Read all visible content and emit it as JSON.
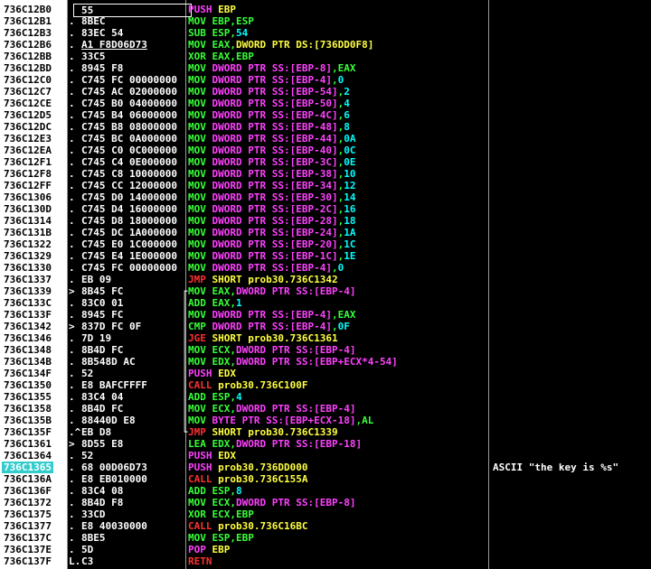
{
  "rows": [
    {
      "addr": "736C12B0",
      "mark": "",
      "hex": "55",
      "flow": "",
      "op": "PUSH",
      "opcolor": "#ff40ff",
      "args": [
        {
          "t": "EBP",
          "c": "#ffff40"
        }
      ],
      "cmt": "",
      "hdr": true
    },
    {
      "addr": "736C12B1",
      "mark": ".",
      "hex": "8BEC",
      "flow": "",
      "op": "MOV",
      "opcolor": "#38ff38",
      "args": [
        {
          "t": "EBP,ESP",
          "c": "#38ff38"
        }
      ],
      "cmt": ""
    },
    {
      "addr": "736C12B3",
      "mark": ".",
      "hex": "83EC 54",
      "flow": "",
      "op": "SUB",
      "opcolor": "#38ff38",
      "args": [
        {
          "t": "ESP,",
          "c": "#38ff38"
        },
        {
          "t": "54",
          "c": "#00ffff"
        }
      ],
      "cmt": ""
    },
    {
      "addr": "736C12B6",
      "mark": ".",
      "hex": "A1 F8D06D73",
      "flow": "",
      "op": "MOV",
      "opcolor": "#38ff38",
      "args": [
        {
          "t": "EAX,",
          "c": "#38ff38"
        },
        {
          "t": "DWORD PTR DS:[736DD0F8]",
          "c": "#ffff40"
        }
      ],
      "cmt": "",
      "ul": true
    },
    {
      "addr": "736C12BB",
      "mark": ".",
      "hex": "33C5",
      "flow": "",
      "op": "XOR",
      "opcolor": "#38ff38",
      "args": [
        {
          "t": "EAX,EBP",
          "c": "#38ff38"
        }
      ],
      "cmt": ""
    },
    {
      "addr": "736C12BD",
      "mark": ".",
      "hex": "8945 F8",
      "flow": "",
      "op": "MOV",
      "opcolor": "#38ff38",
      "args": [
        {
          "t": "DWORD PTR SS:[EBP-8]",
          "c": "#ff40ff"
        },
        {
          "t": ",EAX",
          "c": "#38ff38"
        }
      ],
      "cmt": ""
    },
    {
      "addr": "736C12C0",
      "mark": ".",
      "hex": "C745 FC 00000000",
      "flow": "",
      "op": "MOV",
      "opcolor": "#38ff38",
      "args": [
        {
          "t": "DWORD PTR SS:[EBP-4]",
          "c": "#ff40ff"
        },
        {
          "t": ",",
          "c": "#38ff38"
        },
        {
          "t": "0",
          "c": "#00ffff"
        }
      ],
      "cmt": ""
    },
    {
      "addr": "736C12C7",
      "mark": ".",
      "hex": "C745 AC 02000000",
      "flow": "",
      "op": "MOV",
      "opcolor": "#38ff38",
      "args": [
        {
          "t": "DWORD PTR SS:[EBP-54]",
          "c": "#ff40ff"
        },
        {
          "t": ",",
          "c": "#38ff38"
        },
        {
          "t": "2",
          "c": "#00ffff"
        }
      ],
      "cmt": ""
    },
    {
      "addr": "736C12CE",
      "mark": ".",
      "hex": "C745 B0 04000000",
      "flow": "",
      "op": "MOV",
      "opcolor": "#38ff38",
      "args": [
        {
          "t": "DWORD PTR SS:[EBP-50]",
          "c": "#ff40ff"
        },
        {
          "t": ",",
          "c": "#38ff38"
        },
        {
          "t": "4",
          "c": "#00ffff"
        }
      ],
      "cmt": ""
    },
    {
      "addr": "736C12D5",
      "mark": ".",
      "hex": "C745 B4 06000000",
      "flow": "",
      "op": "MOV",
      "opcolor": "#38ff38",
      "args": [
        {
          "t": "DWORD PTR SS:[EBP-4C]",
          "c": "#ff40ff"
        },
        {
          "t": ",",
          "c": "#38ff38"
        },
        {
          "t": "6",
          "c": "#00ffff"
        }
      ],
      "cmt": ""
    },
    {
      "addr": "736C12DC",
      "mark": ".",
      "hex": "C745 B8 08000000",
      "flow": "",
      "op": "MOV",
      "opcolor": "#38ff38",
      "args": [
        {
          "t": "DWORD PTR SS:[EBP-48]",
          "c": "#ff40ff"
        },
        {
          "t": ",",
          "c": "#38ff38"
        },
        {
          "t": "8",
          "c": "#00ffff"
        }
      ],
      "cmt": ""
    },
    {
      "addr": "736C12E3",
      "mark": ".",
      "hex": "C745 BC 0A000000",
      "flow": "",
      "op": "MOV",
      "opcolor": "#38ff38",
      "args": [
        {
          "t": "DWORD PTR SS:[EBP-44]",
          "c": "#ff40ff"
        },
        {
          "t": ",",
          "c": "#38ff38"
        },
        {
          "t": "0A",
          "c": "#00ffff"
        }
      ],
      "cmt": ""
    },
    {
      "addr": "736C12EA",
      "mark": ".",
      "hex": "C745 C0 0C000000",
      "flow": "",
      "op": "MOV",
      "opcolor": "#38ff38",
      "args": [
        {
          "t": "DWORD PTR SS:[EBP-40]",
          "c": "#ff40ff"
        },
        {
          "t": ",",
          "c": "#38ff38"
        },
        {
          "t": "0C",
          "c": "#00ffff"
        }
      ],
      "cmt": ""
    },
    {
      "addr": "736C12F1",
      "mark": ".",
      "hex": "C745 C4 0E000000",
      "flow": "",
      "op": "MOV",
      "opcolor": "#38ff38",
      "args": [
        {
          "t": "DWORD PTR SS:[EBP-3C]",
          "c": "#ff40ff"
        },
        {
          "t": ",",
          "c": "#38ff38"
        },
        {
          "t": "0E",
          "c": "#00ffff"
        }
      ],
      "cmt": ""
    },
    {
      "addr": "736C12F8",
      "mark": ".",
      "hex": "C745 C8 10000000",
      "flow": "",
      "op": "MOV",
      "opcolor": "#38ff38",
      "args": [
        {
          "t": "DWORD PTR SS:[EBP-38]",
          "c": "#ff40ff"
        },
        {
          "t": ",",
          "c": "#38ff38"
        },
        {
          "t": "10",
          "c": "#00ffff"
        }
      ],
      "cmt": ""
    },
    {
      "addr": "736C12FF",
      "mark": ".",
      "hex": "C745 CC 12000000",
      "flow": "",
      "op": "MOV",
      "opcolor": "#38ff38",
      "args": [
        {
          "t": "DWORD PTR SS:[EBP-34]",
          "c": "#ff40ff"
        },
        {
          "t": ",",
          "c": "#38ff38"
        },
        {
          "t": "12",
          "c": "#00ffff"
        }
      ],
      "cmt": ""
    },
    {
      "addr": "736C1306",
      "mark": ".",
      "hex": "C745 D0 14000000",
      "flow": "",
      "op": "MOV",
      "opcolor": "#38ff38",
      "args": [
        {
          "t": "DWORD PTR SS:[EBP-30]",
          "c": "#ff40ff"
        },
        {
          "t": ",",
          "c": "#38ff38"
        },
        {
          "t": "14",
          "c": "#00ffff"
        }
      ],
      "cmt": ""
    },
    {
      "addr": "736C130D",
      "mark": ".",
      "hex": "C745 D4 16000000",
      "flow": "",
      "op": "MOV",
      "opcolor": "#38ff38",
      "args": [
        {
          "t": "DWORD PTR SS:[EBP-2C]",
          "c": "#ff40ff"
        },
        {
          "t": ",",
          "c": "#38ff38"
        },
        {
          "t": "16",
          "c": "#00ffff"
        }
      ],
      "cmt": ""
    },
    {
      "addr": "736C1314",
      "mark": ".",
      "hex": "C745 D8 18000000",
      "flow": "",
      "op": "MOV",
      "opcolor": "#38ff38",
      "args": [
        {
          "t": "DWORD PTR SS:[EBP-28]",
          "c": "#ff40ff"
        },
        {
          "t": ",",
          "c": "#38ff38"
        },
        {
          "t": "18",
          "c": "#00ffff"
        }
      ],
      "cmt": ""
    },
    {
      "addr": "736C131B",
      "mark": ".",
      "hex": "C745 DC 1A000000",
      "flow": "",
      "op": "MOV",
      "opcolor": "#38ff38",
      "args": [
        {
          "t": "DWORD PTR SS:[EBP-24]",
          "c": "#ff40ff"
        },
        {
          "t": ",",
          "c": "#38ff38"
        },
        {
          "t": "1A",
          "c": "#00ffff"
        }
      ],
      "cmt": ""
    },
    {
      "addr": "736C1322",
      "mark": ".",
      "hex": "C745 E0 1C000000",
      "flow": "",
      "op": "MOV",
      "opcolor": "#38ff38",
      "args": [
        {
          "t": "DWORD PTR SS:[EBP-20]",
          "c": "#ff40ff"
        },
        {
          "t": ",",
          "c": "#38ff38"
        },
        {
          "t": "1C",
          "c": "#00ffff"
        }
      ],
      "cmt": ""
    },
    {
      "addr": "736C1329",
      "mark": ".",
      "hex": "C745 E4 1E000000",
      "flow": "",
      "op": "MOV",
      "opcolor": "#38ff38",
      "args": [
        {
          "t": "DWORD PTR SS:[EBP-1C]",
          "c": "#ff40ff"
        },
        {
          "t": ",",
          "c": "#38ff38"
        },
        {
          "t": "1E",
          "c": "#00ffff"
        }
      ],
      "cmt": ""
    },
    {
      "addr": "736C1330",
      "mark": ".",
      "hex": "C745 FC 00000000",
      "flow": "",
      "op": "MOV",
      "opcolor": "#38ff38",
      "args": [
        {
          "t": "DWORD PTR SS:[EBP-4]",
          "c": "#ff40ff"
        },
        {
          "t": ",",
          "c": "#38ff38"
        },
        {
          "t": "0",
          "c": "#00ffff"
        }
      ],
      "cmt": ""
    },
    {
      "addr": "736C1337",
      "mark": ".",
      "hex": "EB 09",
      "flow": "",
      "op": "JMP",
      "opcolor": "#ff3030",
      "args": [
        {
          "t": "SHORT prob30.736C1342",
          "c": "#ffff40"
        }
      ],
      "cmt": ""
    },
    {
      "addr": "736C1339",
      "mark": ">",
      "hex": "8B45 FC",
      "flow": "┌",
      "op": "MOV",
      "opcolor": "#38ff38",
      "args": [
        {
          "t": "EAX,",
          "c": "#38ff38"
        },
        {
          "t": "DWORD PTR SS:[EBP-4]",
          "c": "#ff40ff"
        }
      ],
      "cmt": ""
    },
    {
      "addr": "736C133C",
      "mark": ".",
      "hex": "83C0 01",
      "flow": "│",
      "op": "ADD",
      "opcolor": "#38ff38",
      "args": [
        {
          "t": "EAX,",
          "c": "#38ff38"
        },
        {
          "t": "1",
          "c": "#00ffff"
        }
      ],
      "cmt": ""
    },
    {
      "addr": "736C133F",
      "mark": ".",
      "hex": "8945 FC",
      "flow": "│",
      "op": "MOV",
      "opcolor": "#38ff38",
      "args": [
        {
          "t": "DWORD PTR SS:[EBP-4]",
          "c": "#ff40ff"
        },
        {
          "t": ",EAX",
          "c": "#38ff38"
        }
      ],
      "cmt": ""
    },
    {
      "addr": "736C1342",
      "mark": ">",
      "hex": "837D FC 0F",
      "flow": "│",
      "op": "CMP",
      "opcolor": "#38ff38",
      "args": [
        {
          "t": "DWORD PTR SS:[EBP-4]",
          "c": "#ff40ff"
        },
        {
          "t": ",",
          "c": "#38ff38"
        },
        {
          "t": "0F",
          "c": "#00ffff"
        }
      ],
      "cmt": ""
    },
    {
      "addr": "736C1346",
      "mark": ".",
      "hex": "7D 19",
      "flow": "│",
      "op": "JGE",
      "opcolor": "#ff3030",
      "args": [
        {
          "t": "SHORT prob30.736C1361",
          "c": "#ffff40"
        }
      ],
      "cmt": ""
    },
    {
      "addr": "736C1348",
      "mark": ".",
      "hex": "8B4D FC",
      "flow": "│",
      "op": "MOV",
      "opcolor": "#38ff38",
      "args": [
        {
          "t": "ECX,",
          "c": "#38ff38"
        },
        {
          "t": "DWORD PTR SS:[EBP-4]",
          "c": "#ff40ff"
        }
      ],
      "cmt": ""
    },
    {
      "addr": "736C134B",
      "mark": ".",
      "hex": "8B548D AC",
      "flow": "│",
      "op": "MOV",
      "opcolor": "#38ff38",
      "args": [
        {
          "t": "EDX,",
          "c": "#38ff38"
        },
        {
          "t": "DWORD PTR SS:[EBP+ECX*4-54]",
          "c": "#ff40ff"
        }
      ],
      "cmt": ""
    },
    {
      "addr": "736C134F",
      "mark": ".",
      "hex": "52",
      "flow": "│",
      "op": "PUSH",
      "opcolor": "#ff40ff",
      "args": [
        {
          "t": "EDX",
          "c": "#ffff40"
        }
      ],
      "cmt": ""
    },
    {
      "addr": "736C1350",
      "mark": ".",
      "hex": "E8 BAFCFFFF",
      "flow": "│",
      "op": "CALL",
      "opcolor": "#ff3030",
      "args": [
        {
          "t": "prob30.736C100F",
          "c": "#ffff40"
        }
      ],
      "cmt": ""
    },
    {
      "addr": "736C1355",
      "mark": ".",
      "hex": "83C4 04",
      "flow": "│",
      "op": "ADD",
      "opcolor": "#38ff38",
      "args": [
        {
          "t": "ESP,",
          "c": "#38ff38"
        },
        {
          "t": "4",
          "c": "#00ffff"
        }
      ],
      "cmt": ""
    },
    {
      "addr": "736C1358",
      "mark": ".",
      "hex": "8B4D FC",
      "flow": "│",
      "op": "MOV",
      "opcolor": "#38ff38",
      "args": [
        {
          "t": "ECX,",
          "c": "#38ff38"
        },
        {
          "t": "DWORD PTR SS:[EBP-4]",
          "c": "#ff40ff"
        }
      ],
      "cmt": ""
    },
    {
      "addr": "736C135B",
      "mark": ".",
      "hex": "88440D E8",
      "flow": "│",
      "op": "MOV",
      "opcolor": "#38ff38",
      "args": [
        {
          "t": "BYTE PTR SS:[EBP+ECX-18]",
          "c": "#ff40ff"
        },
        {
          "t": ",AL",
          "c": "#38ff38"
        }
      ],
      "cmt": ""
    },
    {
      "addr": "736C135F",
      "mark": ".^",
      "hex": "EB D8",
      "flow": "└",
      "op": "JMP",
      "opcolor": "#ff3030",
      "args": [
        {
          "t": "SHORT prob30.736C1339",
          "c": "#ffff40"
        }
      ],
      "cmt": ""
    },
    {
      "addr": "736C1361",
      "mark": ">",
      "hex": "8D55 E8",
      "flow": "",
      "op": "LEA",
      "opcolor": "#38ff38",
      "args": [
        {
          "t": "EDX,",
          "c": "#38ff38"
        },
        {
          "t": "DWORD PTR SS:[EBP-18]",
          "c": "#ff40ff"
        }
      ],
      "cmt": ""
    },
    {
      "addr": "736C1364",
      "mark": ".",
      "hex": "52",
      "flow": "",
      "op": "PUSH",
      "opcolor": "#ff40ff",
      "args": [
        {
          "t": "EDX",
          "c": "#ffff40"
        }
      ],
      "cmt": ""
    },
    {
      "addr": "736C1365",
      "mark": ".",
      "hex": "68 00D06D73",
      "flow": "",
      "op": "PUSH",
      "opcolor": "#ff40ff",
      "args": [
        {
          "t": "prob30.736DD000",
          "c": "#ffff40"
        }
      ],
      "cmt": "ASCII \"the key is %s\"",
      "sel": true
    },
    {
      "addr": "736C136A",
      "mark": ".",
      "hex": "E8 EB010000",
      "flow": "",
      "op": "CALL",
      "opcolor": "#ff3030",
      "args": [
        {
          "t": "prob30.736C155A",
          "c": "#ffff40"
        }
      ],
      "cmt": ""
    },
    {
      "addr": "736C136F",
      "mark": ".",
      "hex": "83C4 08",
      "flow": "",
      "op": "ADD",
      "opcolor": "#38ff38",
      "args": [
        {
          "t": "ESP,",
          "c": "#38ff38"
        },
        {
          "t": "8",
          "c": "#00ffff"
        }
      ],
      "cmt": ""
    },
    {
      "addr": "736C1372",
      "mark": ".",
      "hex": "8B4D F8",
      "flow": "",
      "op": "MOV",
      "opcolor": "#38ff38",
      "args": [
        {
          "t": "ECX,",
          "c": "#38ff38"
        },
        {
          "t": "DWORD PTR SS:[EBP-8]",
          "c": "#ff40ff"
        }
      ],
      "cmt": ""
    },
    {
      "addr": "736C1375",
      "mark": ".",
      "hex": "33CD",
      "flow": "",
      "op": "XOR",
      "opcolor": "#38ff38",
      "args": [
        {
          "t": "ECX,EBP",
          "c": "#38ff38"
        }
      ],
      "cmt": ""
    },
    {
      "addr": "736C1377",
      "mark": ".",
      "hex": "E8 40030000",
      "flow": "",
      "op": "CALL",
      "opcolor": "#ff3030",
      "args": [
        {
          "t": "prob30.736C16BC",
          "c": "#ffff40"
        }
      ],
      "cmt": ""
    },
    {
      "addr": "736C137C",
      "mark": ".",
      "hex": "8BE5",
      "flow": "",
      "op": "MOV",
      "opcolor": "#38ff38",
      "args": [
        {
          "t": "ESP,EBP",
          "c": "#38ff38"
        }
      ],
      "cmt": ""
    },
    {
      "addr": "736C137E",
      "mark": ".",
      "hex": "5D",
      "flow": "",
      "op": "POP",
      "opcolor": "#ff40ff",
      "args": [
        {
          "t": "EBP",
          "c": "#ffff40"
        }
      ],
      "cmt": ""
    },
    {
      "addr": "736C137F",
      "mark": "L.",
      "hex": "C3",
      "flow": "",
      "op": "RETN",
      "opcolor": "#ff3030",
      "args": [],
      "cmt": ""
    }
  ]
}
